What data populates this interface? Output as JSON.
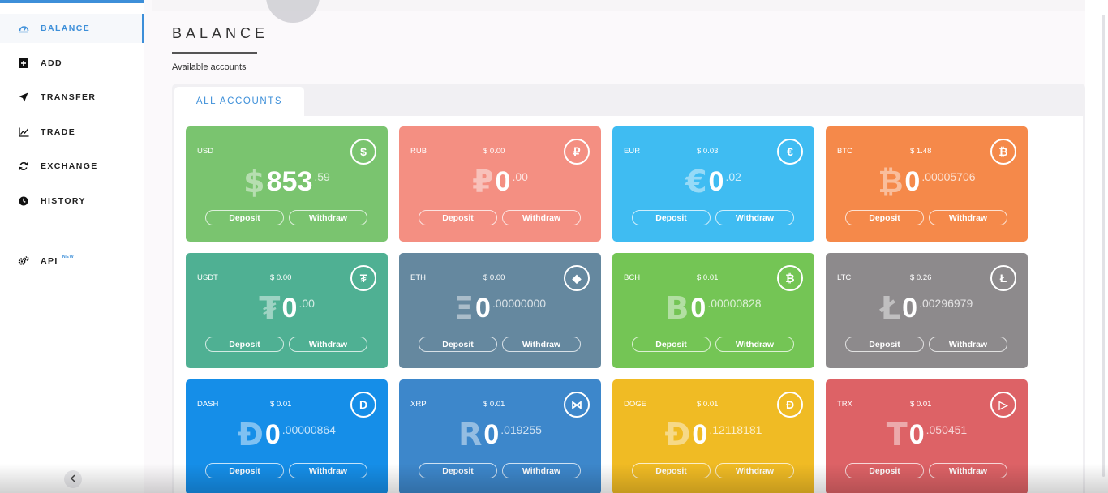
{
  "sidebar": {
    "items": [
      {
        "label": "BALANCE",
        "icon": "dashboard-icon",
        "active": true
      },
      {
        "label": "ADD",
        "icon": "plus-square-icon"
      },
      {
        "label": "TRANSFER",
        "icon": "paper-plane-icon"
      },
      {
        "label": "TRADE",
        "icon": "chart-line-icon"
      },
      {
        "label": "EXCHANGE",
        "icon": "refresh-icon"
      },
      {
        "label": "HISTORY",
        "icon": "clock-icon"
      }
    ],
    "api": {
      "label": "API",
      "badge": "NEW",
      "icon": "gears-icon"
    },
    "collapse_icon": "chevron-left-icon"
  },
  "page": {
    "title": "BALANCE",
    "subtitle": "Available accounts",
    "tab": "ALL ACCOUNTS"
  },
  "labels": {
    "deposit": "Deposit",
    "withdraw": "Withdraw"
  },
  "cards": [
    {
      "code": "USD",
      "usd": "",
      "symbol": "$",
      "int": "853",
      "frac": ".59",
      "icon_glyph": "$",
      "color": "#7ac46f"
    },
    {
      "code": "RUB",
      "usd": "$ 0.00",
      "symbol": "₽",
      "int": "0",
      "frac": ".00",
      "icon_glyph": "₽",
      "color": "#f48f82"
    },
    {
      "code": "EUR",
      "usd": "$ 0.03",
      "symbol": "€",
      "int": "0",
      "frac": ".02",
      "icon_glyph": "€",
      "color": "#3fbcf2"
    },
    {
      "code": "BTC",
      "usd": "$ 1.48",
      "symbol": "₿",
      "int": "0",
      "frac": ".00005706",
      "icon_glyph": "₿",
      "color": "#f5894a"
    },
    {
      "code": "USDT",
      "usd": "$ 0.00",
      "symbol": "₮",
      "int": "0",
      "frac": ".00",
      "icon_glyph": "₮",
      "color": "#4fb093"
    },
    {
      "code": "ETH",
      "usd": "$ 0.00",
      "symbol": "Ξ",
      "int": "0",
      "frac": ".00000000",
      "icon_glyph": "◆",
      "color": "#65889f"
    },
    {
      "code": "BCH",
      "usd": "$ 0.01",
      "symbol": "B",
      "int": "0",
      "frac": ".00000828",
      "icon_glyph": "₿",
      "color": "#74c555"
    },
    {
      "code": "LTC",
      "usd": "$ 0.26",
      "symbol": "Ł",
      "int": "0",
      "frac": ".00296979",
      "icon_glyph": "Ł",
      "color": "#8d8a8c"
    },
    {
      "code": "DASH",
      "usd": "$ 0.01",
      "symbol": "Đ",
      "int": "0",
      "frac": ".00000864",
      "icon_glyph": "D",
      "color": "#158ee8"
    },
    {
      "code": "XRP",
      "usd": "$ 0.01",
      "symbol": "R",
      "int": "0",
      "frac": ".019255",
      "icon_glyph": "⋈",
      "color": "#3d87cb"
    },
    {
      "code": "DOGE",
      "usd": "$ 0.01",
      "symbol": "Đ",
      "int": "0",
      "frac": ".12118181",
      "icon_glyph": "Đ",
      "color": "#f0bb24"
    },
    {
      "code": "TRX",
      "usd": "$ 0.01",
      "symbol": "T",
      "int": "0",
      "frac": ".050451",
      "icon_glyph": "▷",
      "color": "#dd6266"
    }
  ]
}
